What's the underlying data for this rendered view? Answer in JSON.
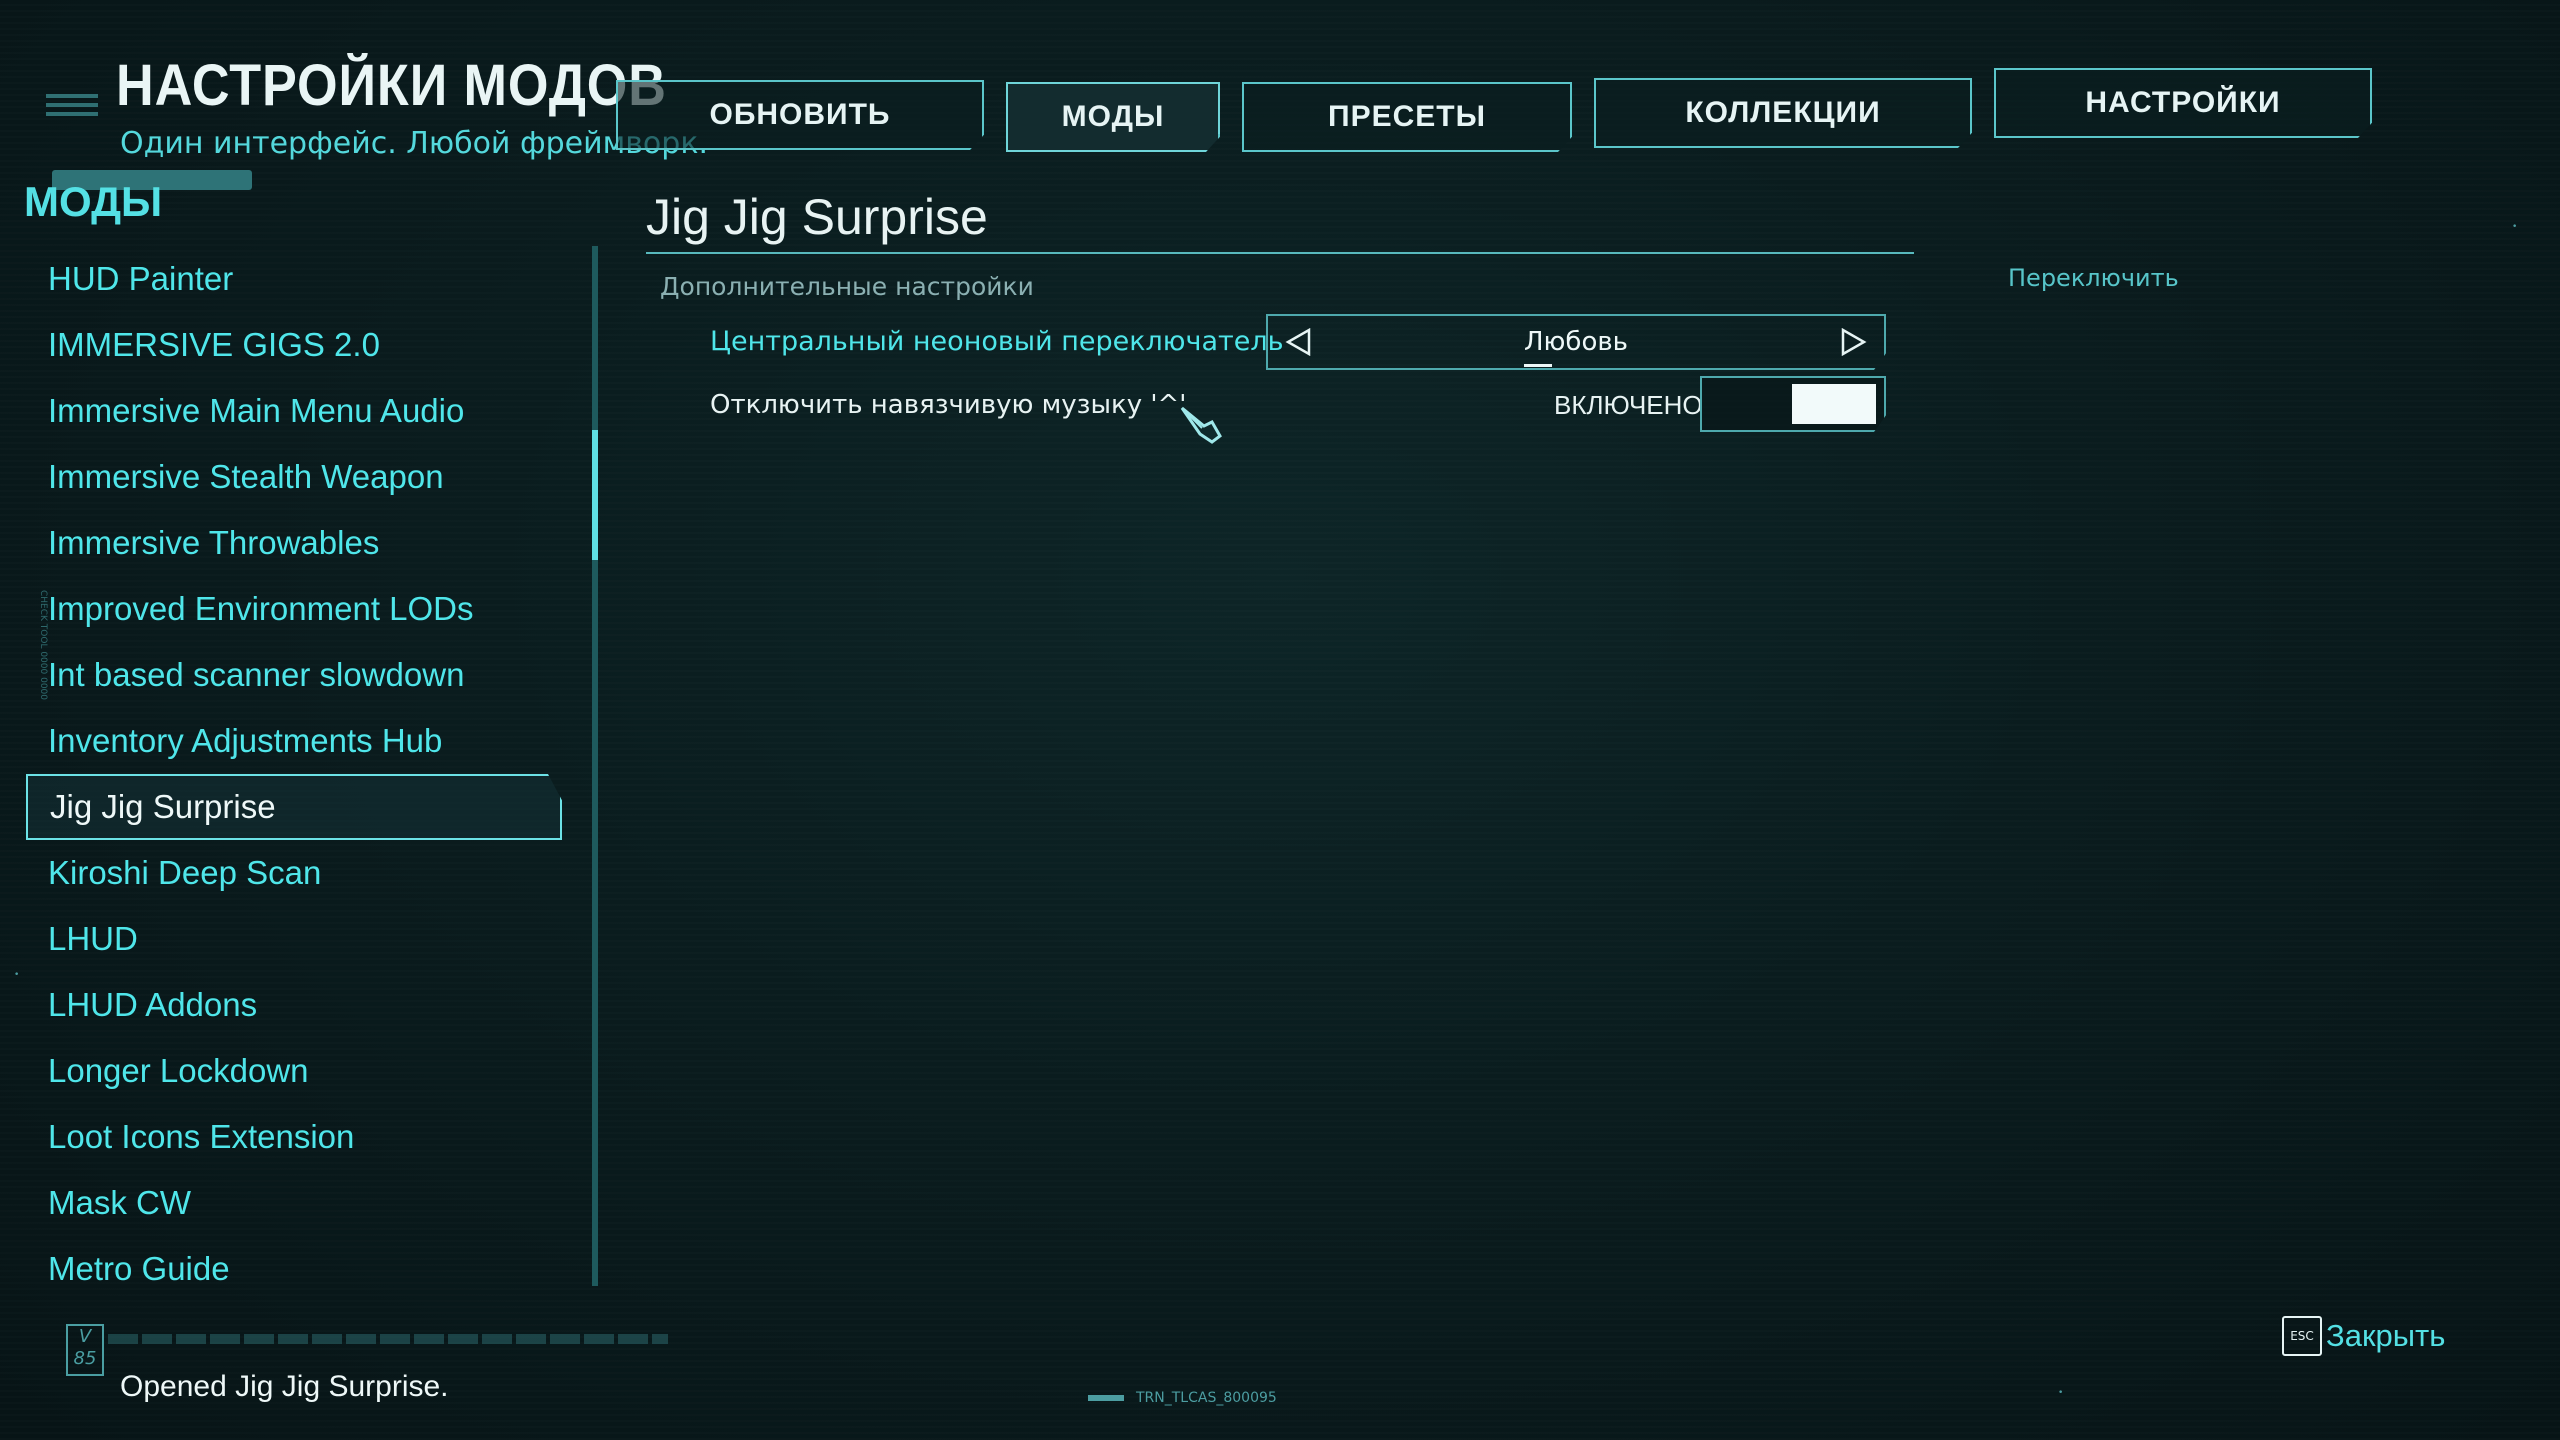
{
  "header": {
    "title": "НАСТРОЙКИ МОДОВ",
    "subtitle": "Один интерфейс. Любой фреймворк."
  },
  "tabs": [
    {
      "label": "ОБНОВИТЬ"
    },
    {
      "label": "МОДЫ"
    },
    {
      "label": "ПРЕСЕТЫ"
    },
    {
      "label": "КОЛЛЕКЦИИ"
    },
    {
      "label": "НАСТРОЙКИ"
    }
  ],
  "sidebar": {
    "heading": "МОДЫ",
    "items": [
      {
        "label": "HUD Painter"
      },
      {
        "label": "IMMERSIVE GIGS 2.0"
      },
      {
        "label": "Immersive Main Menu Audio"
      },
      {
        "label": "Immersive Stealth Weapon"
      },
      {
        "label": "Immersive Throwables"
      },
      {
        "label": "Improved Environment LODs"
      },
      {
        "label": "Int based scanner slowdown"
      },
      {
        "label": "Inventory Adjustments Hub"
      },
      {
        "label": "Jig Jig Surprise"
      },
      {
        "label": "Kiroshi Deep Scan"
      },
      {
        "label": "LHUD"
      },
      {
        "label": "LHUD Addons"
      },
      {
        "label": "Longer Lockdown"
      },
      {
        "label": "Loot Icons Extension"
      },
      {
        "label": "Mask CW"
      },
      {
        "label": "Metro Guide"
      }
    ]
  },
  "main": {
    "mod_title": "Jig Jig Surprise",
    "section": "Дополнительные настройки",
    "option1": {
      "label": "Центральный неоновый переключатель",
      "value": "Любовь"
    },
    "option2": {
      "label": "Отключить навязчивую музыку '^'",
      "state": "ВКЛЮЧЕНО"
    },
    "hint": "Переключить"
  },
  "footer": {
    "version": "V 85",
    "status": "Opened Jig Jig Surprise.",
    "code": "TRN_TLCAS_800095",
    "esc_key": "ESC",
    "close": "Закрыть"
  },
  "colors": {
    "accent": "#4fe6ea",
    "text_light": "#e8f3f3",
    "border": "#5bc6ca",
    "background": "#0a1c1e"
  }
}
